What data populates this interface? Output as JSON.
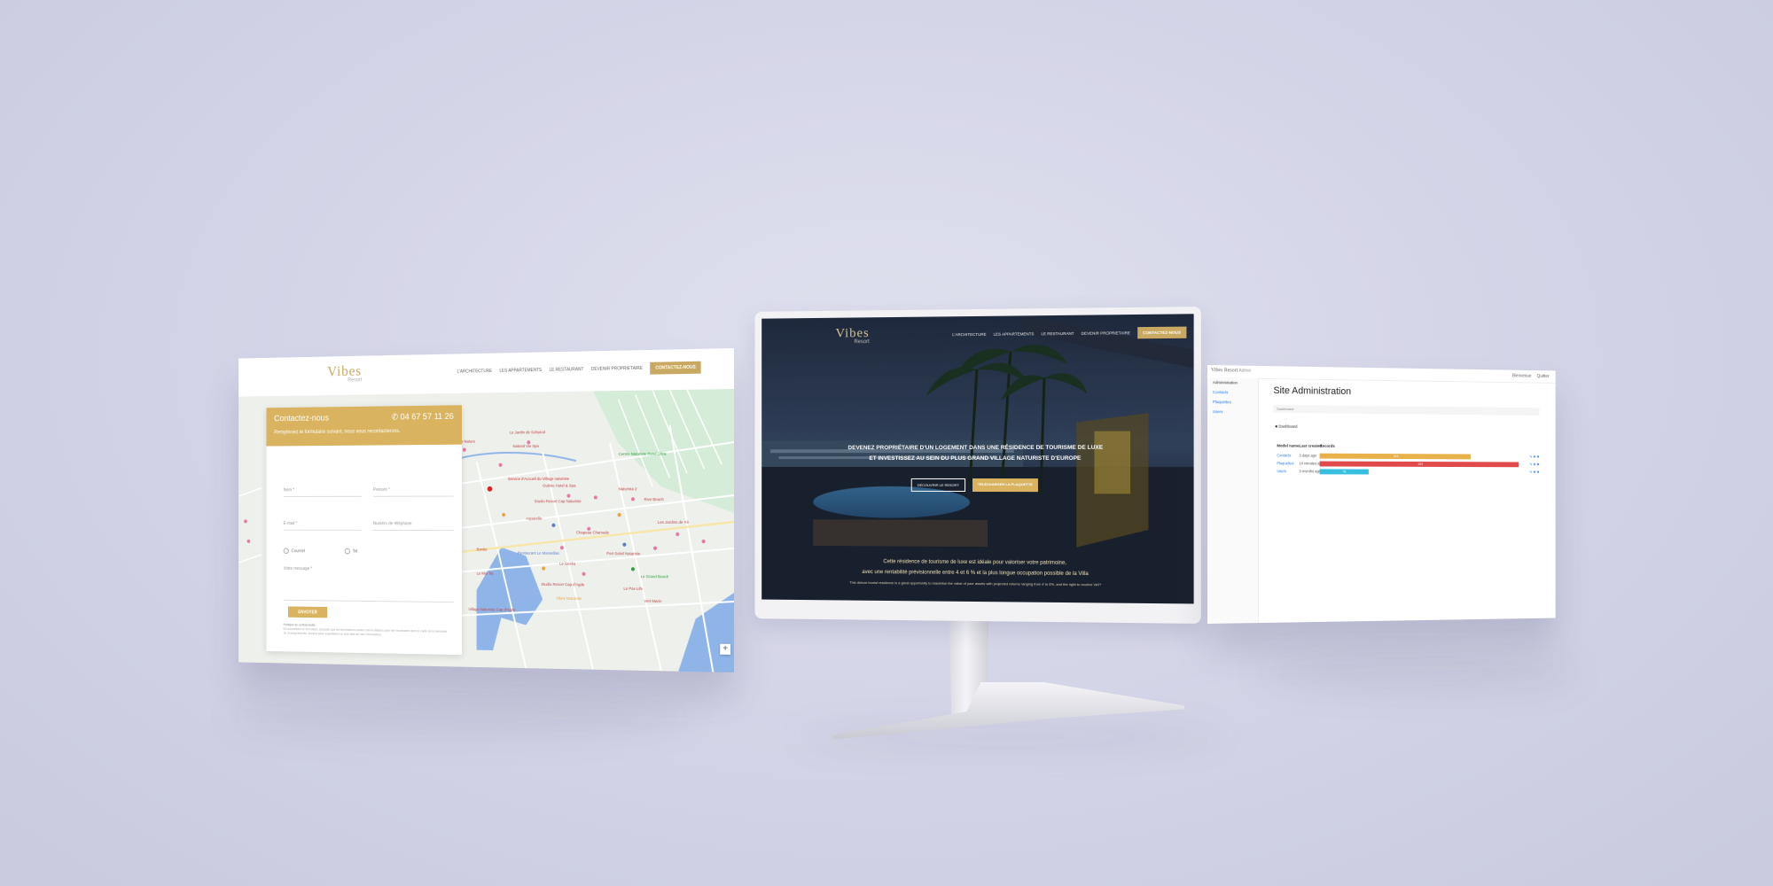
{
  "left_page": {
    "logo": "Vibes",
    "logo_sub": "Resort",
    "nav": [
      "L'ARCHITECTURE",
      "LES APPARTEMENTS",
      "LE RESTAURANT",
      "DEVENIR PROPRIETAIRE"
    ],
    "nav_cta": "CONTACTEZ-NOUS",
    "contact": {
      "title": "Contactez-nous",
      "phone": "04 67 57 11 26",
      "subtitle": "Remplissez le formulaire suivant, nous vous recontacterons.",
      "fields": [
        "Nom *",
        "Prénom *",
        "E-mail *",
        "Numéro de téléphone",
        "Votre message *"
      ],
      "radio_options": [
        "Courriel",
        "Tel"
      ],
      "send_label": "ENVOYER",
      "privacy_title": "Politique de confidentialité",
      "privacy_text": "En soumettant ce formulaire, j'accepte que les informations saisies soient utilisées pour me recontacter dans le cadre de la demande de renseignements. Aucune autre exploitation ne sera faite de mes informations."
    },
    "map": {
      "pois": [
        "Pharmacie Nature",
        "Le Jardin de Sohpicol",
        "Natural Vie Spa",
        "Service d'Accueil du Village naturiste",
        "Centre Naturiste René Oltra",
        "Outline Hotel & Spa",
        "Studio Resort Cap Naturiste",
        "Naturista 2",
        "Rive Beach",
        "Aquarelle",
        "Restaurant Le Marseillan",
        "Chapeau Chamade",
        "Studio Resort Cap d'Agde",
        "Port Soleil Naturiste",
        "Le Gecko",
        "Le Grand Beach",
        "Village Naturiste Cap d'Agde",
        "Les Jardins de Yé",
        "Le Mai Tai",
        "Bonito",
        "Vibes Naturiste",
        "Vert Marin",
        "Le Pax Life"
      ],
      "zoom": "+"
    }
  },
  "monitor": {
    "logo": "Vibes",
    "logo_sub": "Resort",
    "nav": [
      "L'ARCHITECTURE",
      "LES APPARTEMENTS",
      "LE RESTAURANT",
      "DEVENIR PROPRIETAIRE"
    ],
    "nav_cta": "CONTACTEZ-NOUS",
    "hero_line1": "DEVENEZ PROPRIÉTAIRE D'UN LOGEMENT DANS UNE RÉSIDENCE DE TOURISME DE LUXE",
    "hero_line2": "ET INVESTISSEZ AU SEIN DU PLUS GRAND VILLAGE NATURISTE D'EUROPE",
    "btn_outline": "DÉCOUVRIR LE RESORT",
    "btn_solid": "TÉLÉCHARGER LA PLAQUETTE",
    "desc_line1": "Cette résidence de tourisme de luxe est idéale pour valoriser votre patrimoine,",
    "desc_line2": "avec une rentabilité prévisionnelle entre 4 et 6 % et la plus longue occupation possible de la Villa",
    "desc_en": "This deluxe tourist residence is a great opportunity to maximise the value of your assets with projected returns ranging from 4 to 6%, and the right to receive VAT*"
  },
  "admin": {
    "topbar_title": "Vibes Resort",
    "topbar_sub": "Admin",
    "topbar_right": [
      "Bienvenue",
      "Quitter"
    ],
    "sidebar": [
      "Administration",
      "Contacts",
      "Plaquettes",
      "Users"
    ],
    "title": "Site Administration",
    "breadcrumb": "Dashboard",
    "dashboard_label": "Dashboard",
    "table_headers": [
      "Model name",
      "Last created",
      "Records"
    ],
    "rows": [
      {
        "name": "Contacts",
        "last": "3 days ago",
        "value": 243,
        "color": "#e8b14a"
      },
      {
        "name": "Plaquettes",
        "last": "14 minutes ago",
        "value": 323,
        "color": "#e04a4a"
      },
      {
        "name": "Users",
        "last": "3 months ago",
        "value": 78,
        "color": "#38bfe0"
      }
    ],
    "max_value": 323
  },
  "colors": {
    "gold": "#d9b35f",
    "background": "#d4d5e8"
  }
}
